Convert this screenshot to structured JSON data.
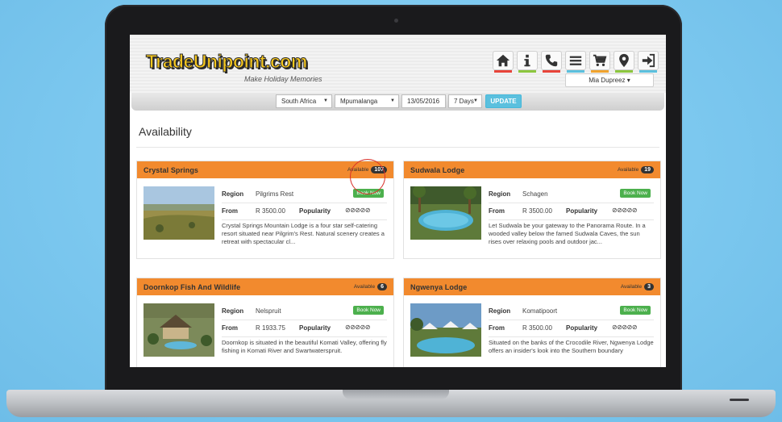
{
  "brand": {
    "logo_text": "TradeUnipoint.com",
    "tagline": "Make Holiday Memories"
  },
  "nav_icons": [
    {
      "name": "home-icon",
      "accent": "#e8443a"
    },
    {
      "name": "info-icon",
      "accent": "#8cc63e"
    },
    {
      "name": "phone-icon",
      "accent": "#e8443a"
    },
    {
      "name": "menu-icon",
      "accent": "#5bc0de"
    },
    {
      "name": "cart-icon",
      "accent": "#f0a32e"
    },
    {
      "name": "location-icon",
      "accent": "#8cc63e"
    },
    {
      "name": "sign-in-icon",
      "accent": "#5bc0de"
    }
  ],
  "user": {
    "name": "Mia Dupreez",
    "caret": "▾"
  },
  "filters": {
    "country": "South Africa",
    "province": "Mpumalanga",
    "date": "13/05/2016",
    "duration": "7 Days",
    "update_label": "UPDATE"
  },
  "page": {
    "title": "Availability"
  },
  "labels": {
    "region": "Region",
    "from": "From",
    "popularity": "Popularity",
    "book": "Book Now",
    "available": "Available"
  },
  "colors": {
    "accent": "#f28a2e",
    "book": "#4cb04d",
    "update": "#5bc0de"
  },
  "listings": [
    {
      "name": "Crystal Springs",
      "available": "107",
      "region": "Pilgrims Rest",
      "price": "R 3500.00",
      "popularity": "⊘⊘⊘⊘⊘",
      "description": "Crystal Springs Mountain Lodge is a four star self-catering resort situated near Pilgrim's Rest. Natural scenery creates a retreat with spectacular cl..."
    },
    {
      "name": "Sudwala Lodge",
      "available": "19",
      "region": "Schagen",
      "price": "R 3500.00",
      "popularity": "⊘⊘⊘⊘⊘",
      "description": "Let Sudwala be your gateway to the Panorama Route. In a wooded valley below the famed Sudwala Caves, the sun rises over relaxing pools and outdoor jac..."
    },
    {
      "name": "Doornkop Fish And Wildlife",
      "available": "6",
      "region": "Nelspruit",
      "price": "R 1933.75",
      "popularity": "⊘⊘⊘⊘⊘",
      "description": "Doornkop is situated in the beautiful Komati Valley, offering fly fishing in Komati River and Swartwaterspruit."
    },
    {
      "name": "Ngwenya Lodge",
      "available": "3",
      "region": "Komatipoort",
      "price": "R 3500.00",
      "popularity": "⊘⊘⊘⊘⊘",
      "description": "Situated on the banks of the Crocodile River, Ngwenya Lodge offers an insider's look into the Southern boundary"
    }
  ]
}
